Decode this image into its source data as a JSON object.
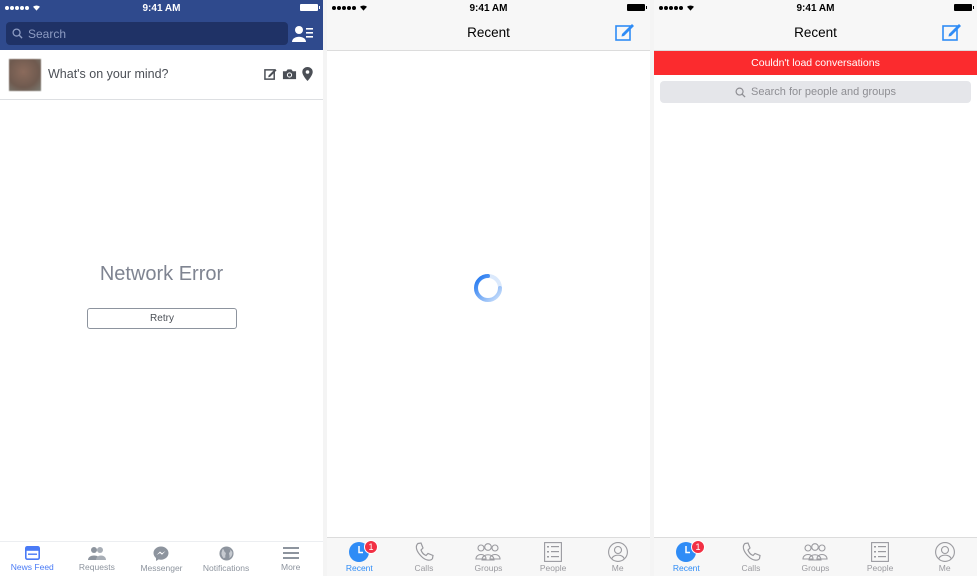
{
  "status_bar": {
    "time": "9:41 AM",
    "signal_dots": 5
  },
  "facebook": {
    "search": {
      "placeholder": "Search"
    },
    "composer": {
      "prompt": "What's on your mind?"
    },
    "error": {
      "title": "Network Error",
      "retry_label": "Retry"
    },
    "tabs": [
      {
        "label": "News Feed",
        "icon": "news-feed-icon",
        "active": true
      },
      {
        "label": "Requests",
        "icon": "friend-requests-icon",
        "active": false
      },
      {
        "label": "Messenger",
        "icon": "messenger-icon",
        "active": false
      },
      {
        "label": "Notifications",
        "icon": "globe-icon",
        "active": false
      },
      {
        "label": "More",
        "icon": "hamburger-icon",
        "active": false
      }
    ],
    "colors": {
      "brand": "#2f4a8d",
      "active_tab": "#4a7bf6"
    }
  },
  "messenger_loading": {
    "title": "Recent",
    "state": "loading"
  },
  "messenger_error": {
    "title": "Recent",
    "error_banner": "Couldn't load conversations",
    "search": {
      "placeholder": "Search for people and groups"
    }
  },
  "messenger_tabs": [
    {
      "label": "Recent",
      "icon": "clock-icon",
      "active": true,
      "badge": "1"
    },
    {
      "label": "Calls",
      "icon": "phone-icon",
      "active": false
    },
    {
      "label": "Groups",
      "icon": "groups-icon",
      "active": false
    },
    {
      "label": "People",
      "icon": "list-icon",
      "active": false
    },
    {
      "label": "Me",
      "icon": "profile-icon",
      "active": false
    }
  ],
  "messenger_colors": {
    "accent": "#2f8cf6",
    "error": "#fb2b2e",
    "badge": "#f23044"
  }
}
